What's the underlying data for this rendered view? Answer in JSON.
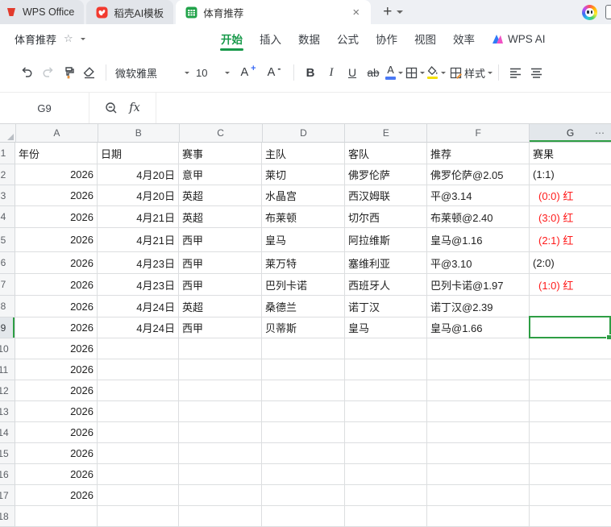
{
  "colors": {
    "accent_green": "#18994a",
    "selection_green": "#2e9e44",
    "result_red": "#ff1a1a",
    "font_color_swatch": "#4a79f5",
    "fill_color_swatch": "#f5df00",
    "tab_bar_bg": "#eef0f4",
    "gridline": "#dcdee0"
  },
  "icons": {
    "star": "☆",
    "close": "×",
    "new_tab": "+",
    "more_columns": "⋯"
  },
  "tab_bar": {
    "tabs": [
      {
        "label": "WPS Office"
      },
      {
        "label": "稻壳AI模板"
      },
      {
        "label": "体育推荐",
        "active": true
      }
    ]
  },
  "menu_bar": {
    "doc_title": "体育推荐",
    "items": [
      {
        "label": "开始",
        "active": true
      },
      {
        "label": "插入"
      },
      {
        "label": "数据"
      },
      {
        "label": "公式"
      },
      {
        "label": "协作"
      },
      {
        "label": "视图"
      },
      {
        "label": "效率"
      },
      {
        "label": "WPS AI"
      }
    ]
  },
  "toolbar": {
    "font_name": "微软雅黑",
    "font_size": "10",
    "bold_label": "B",
    "italic_label": "I",
    "underline_label": "U",
    "strike_label": "ab",
    "font_bigger_label": "A",
    "font_bigger_sign": "+",
    "font_smaller_label": "A",
    "font_smaller_sign": "-",
    "font_color_label": "A",
    "styles_label": "样式"
  },
  "formula_bar": {
    "cell_ref": "G9",
    "fx_label": "fx"
  },
  "grid": {
    "selected_cell": "G9",
    "column_letters": [
      "A",
      "B",
      "C",
      "D",
      "E",
      "F",
      "G"
    ],
    "row_numbers": [
      "1",
      "2",
      "3",
      "4",
      "5",
      "6",
      "7",
      "8",
      "9",
      "10",
      "11",
      "12",
      "13",
      "14",
      "15",
      "16",
      "17",
      "18"
    ],
    "header_row": {
      "a": "年份",
      "b": "日期",
      "c": "赛事",
      "d": "主队",
      "e": "客队",
      "f": "推荐",
      "g": "赛果"
    },
    "data_rows": [
      {
        "year": "2026",
        "date": "4月20日",
        "league": "意甲",
        "home": "莱切",
        "away": "佛罗伦萨",
        "tip": "佛罗伦萨@2.05",
        "result": "(1:1)",
        "result_red": false
      },
      {
        "year": "2026",
        "date": "4月20日",
        "league": "英超",
        "home": "水晶宫",
        "away": "西汉姆联",
        "tip": "平@3.14",
        "result": "(0:0) 红",
        "result_red": true
      },
      {
        "year": "2026",
        "date": "4月21日",
        "league": "英超",
        "home": "布莱顿",
        "away": "切尔西",
        "tip": "布莱顿@2.40",
        "result": "(3:0) 红",
        "result_red": true
      },
      {
        "year": "2026",
        "date": "4月21日",
        "league": "西甲",
        "home": "皇马",
        "away": "阿拉维斯",
        "tip": "皇马@1.16",
        "result": "(2:1) 红",
        "result_red": true
      },
      {
        "year": "2026",
        "date": "4月23日",
        "league": "西甲",
        "home": "莱万特",
        "away": "塞维利亚",
        "tip": "平@3.10",
        "result": "(2:0)",
        "result_red": false
      },
      {
        "year": "2026",
        "date": "4月23日",
        "league": "西甲",
        "home": "巴列卡诺",
        "away": "西班牙人",
        "tip": "巴列卡诺@1.97",
        "result": "(1:0) 红",
        "result_red": true
      },
      {
        "year": "2026",
        "date": "4月24日",
        "league": "英超",
        "home": "桑德兰",
        "away": "诺丁汉",
        "tip": "诺丁汉@2.39",
        "result": "",
        "result_red": false
      },
      {
        "year": "2026",
        "date": "4月24日",
        "league": "西甲",
        "home": "贝蒂斯",
        "away": "皇马",
        "tip": "皇马@1.66",
        "result": "",
        "result_red": false
      }
    ],
    "year_rows": [
      "2026",
      "2026",
      "2026",
      "2026",
      "2026",
      "2026",
      "2026",
      "2026"
    ]
  }
}
